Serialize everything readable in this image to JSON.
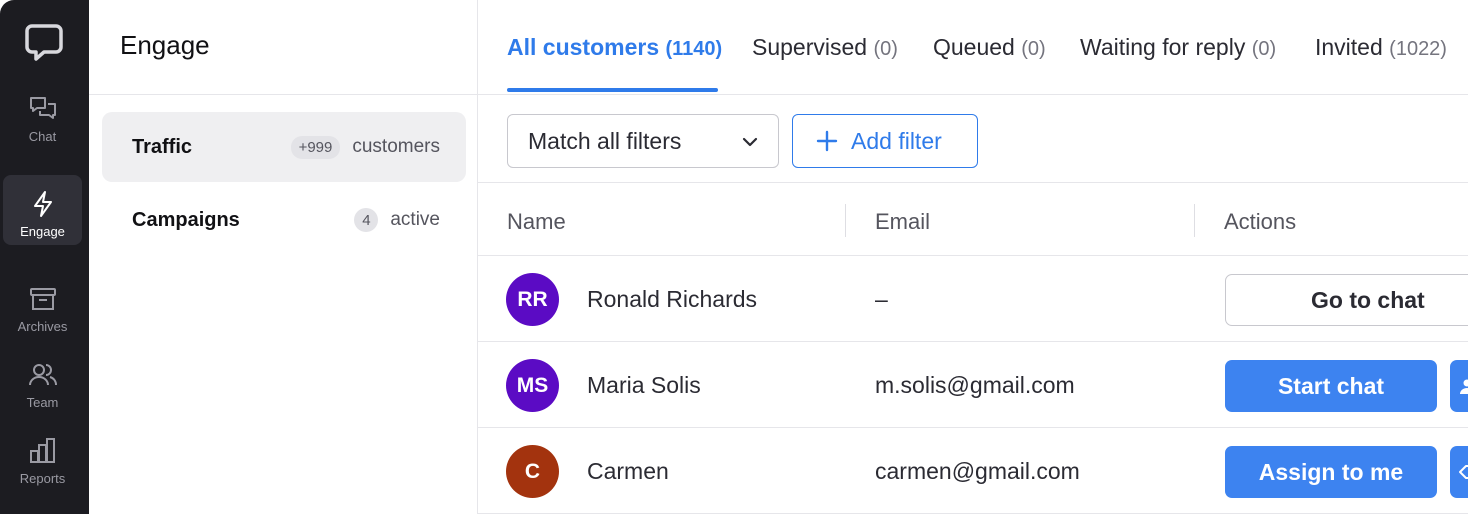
{
  "rail": {
    "items": [
      {
        "label": "Chat",
        "icon": "chat-bubbles-icon"
      },
      {
        "label": "Engage",
        "icon": "lightning-icon",
        "active": true
      },
      {
        "label": "Archives",
        "icon": "archive-box-icon"
      },
      {
        "label": "Team",
        "icon": "team-icon"
      },
      {
        "label": "Reports",
        "icon": "bar-chart-icon"
      }
    ]
  },
  "panel": {
    "title": "Engage",
    "items": [
      {
        "name": "Traffic",
        "badge": "+999",
        "unit": "customers",
        "active": true
      },
      {
        "name": "Campaigns",
        "badge": "4",
        "unit": "active",
        "active": false
      }
    ]
  },
  "tabs": [
    {
      "label": "All customers",
      "count": "(1140)",
      "active": true
    },
    {
      "label": "Supervised",
      "count": "(0)"
    },
    {
      "label": "Queued",
      "count": "(0)"
    },
    {
      "label": "Waiting for reply",
      "count": "(0)"
    },
    {
      "label": "Invited",
      "count": "(1022)"
    }
  ],
  "filters": {
    "match_select": "Match all filters",
    "add_filter": "Add filter"
  },
  "table": {
    "columns": [
      "Name",
      "Email",
      "Actions"
    ],
    "rows": [
      {
        "initials": "RR",
        "avatar_color": "#5b0bc4",
        "name": "Ronald Richards",
        "email": "–",
        "action": "Go to chat"
      },
      {
        "initials": "MS",
        "avatar_color": "#5b0bc4",
        "name": "Maria Solis",
        "email": "m.solis@gmail.com",
        "action": "Start chat"
      },
      {
        "initials": "C",
        "avatar_color": "#a3330e",
        "name": "Carmen",
        "email": "carmen@gmail.com",
        "action": "Assign to me"
      }
    ]
  },
  "colors": {
    "accent": "#2f7bea",
    "button": "#3d83f0",
    "rail_bg": "#1c1c21"
  }
}
